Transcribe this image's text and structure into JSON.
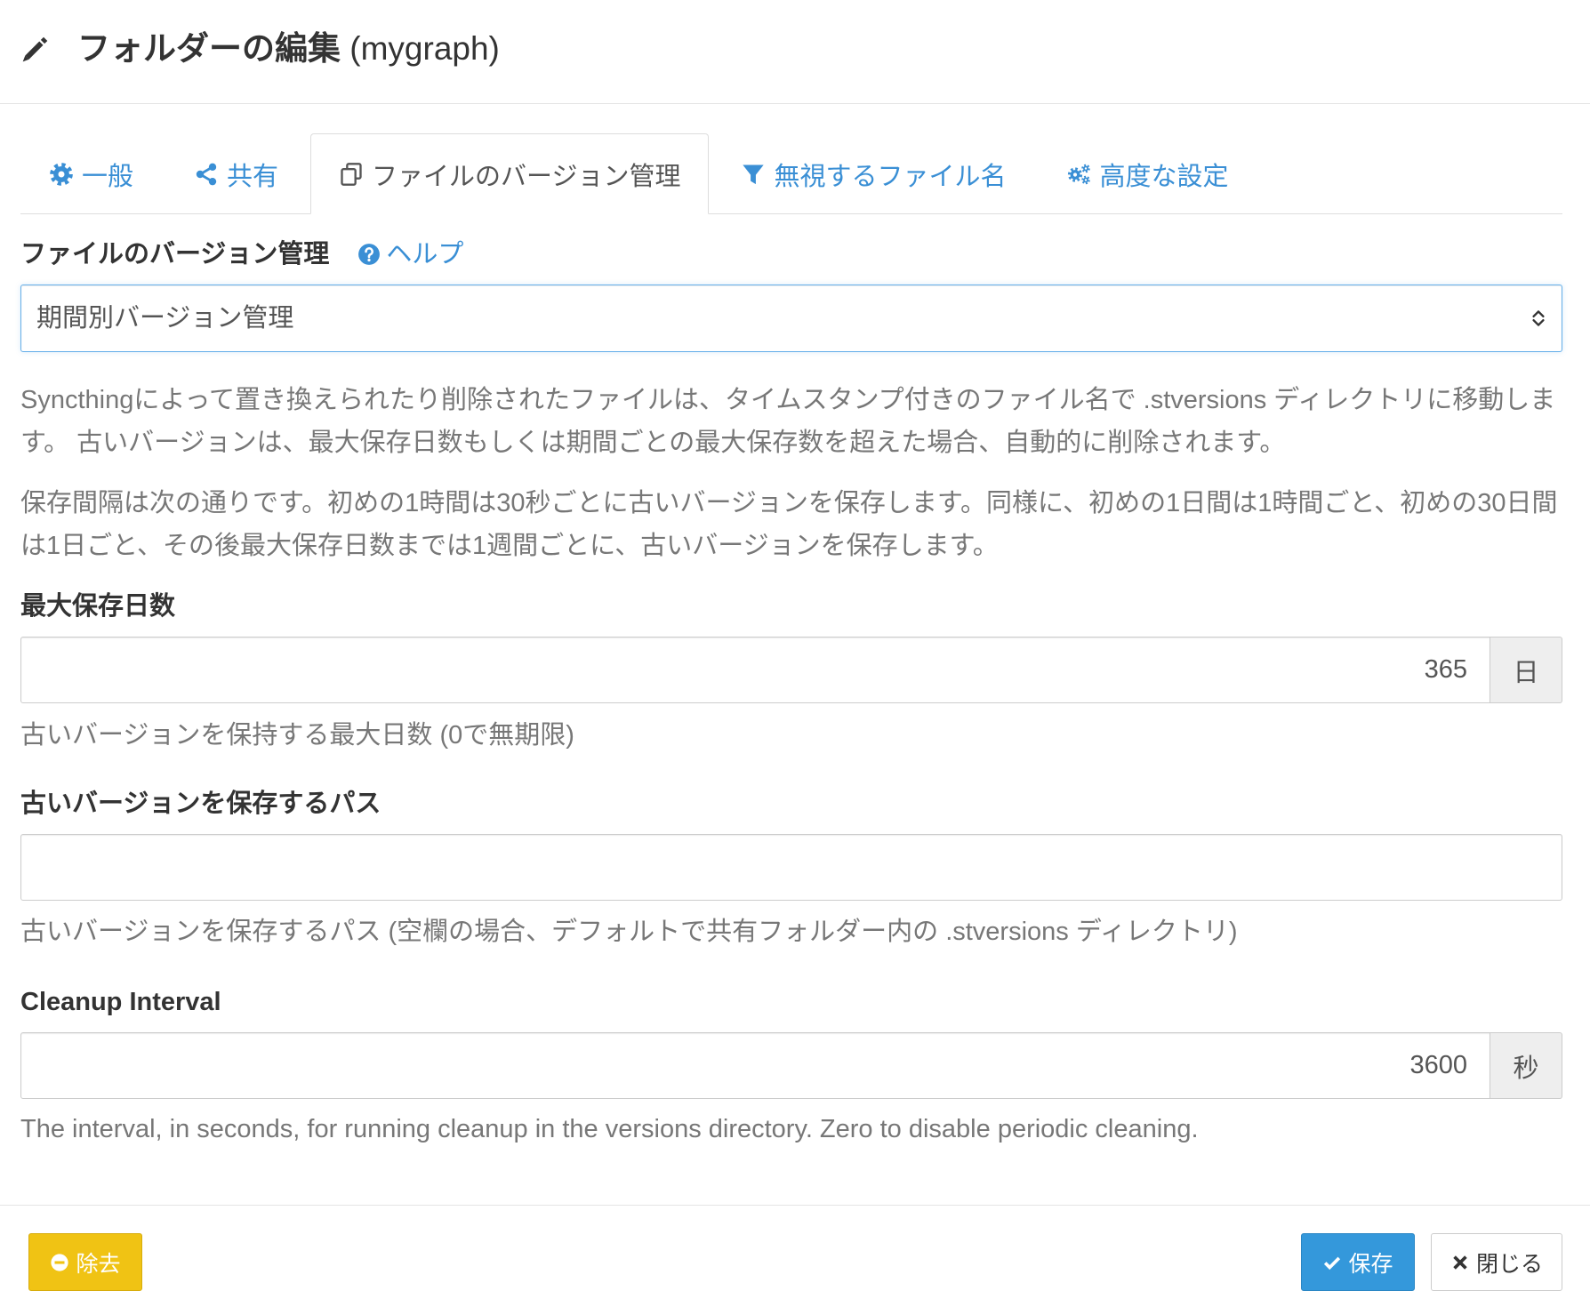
{
  "header": {
    "title": "フォルダーの編集",
    "folder": "(mygraph)"
  },
  "tabs": [
    {
      "label": "一般",
      "icon": "gear-icon"
    },
    {
      "label": "共有",
      "icon": "share-icon"
    },
    {
      "label": "ファイルのバージョン管理",
      "icon": "copy-icon",
      "active": true
    },
    {
      "label": "無視するファイル名",
      "icon": "filter-icon"
    },
    {
      "label": "高度な設定",
      "icon": "cogs-icon"
    }
  ],
  "versioning": {
    "label": "ファイルのバージョン管理",
    "help_icon": "question-circle-icon",
    "help_link": "ヘルプ",
    "selected": "期間別バージョン管理",
    "description": [
      "Syncthingによって置き換えられたり削除されたファイルは、タイムスタンプ付きのファイル名で .stversions ディレクトリに移動します。 古いバージョンは、最大保存日数もしくは期間ごとの最大保存数を超えた場合、自動的に削除されます。",
      "保存間隔は次の通りです。初めの1時間は30秒ごとに古いバージョンを保存します。同様に、初めの1日間は1時間ごと、初めの30日間は1日ごと、その後最大保存日数までは1週間ごとに、古いバージョンを保存します。"
    ]
  },
  "fields": {
    "max_age": {
      "label": "最大保存日数",
      "value": "365",
      "unit": "日",
      "help": "古いバージョンを保持する最大日数 (0で無期限)"
    },
    "versions_path": {
      "label": "古いバージョンを保存するパス",
      "value": "",
      "help": "古いバージョンを保存するパス (空欄の場合、デフォルトで共有フォルダー内の .stversions ディレクトリ)"
    },
    "cleanup_interval": {
      "label": "Cleanup Interval",
      "value": "3600",
      "unit": "秒",
      "help": "The interval, in seconds, for running cleanup in the versions directory. Zero to disable periodic cleaning."
    }
  },
  "footer": {
    "remove": {
      "label": "除去",
      "icon": "minus-circle-icon"
    },
    "save": {
      "label": "保存",
      "icon": "check-icon"
    },
    "close": {
      "label": "閉じる",
      "icon": "times-icon"
    }
  },
  "colors": {
    "link": "#3a8fd5",
    "text": "#333333",
    "muted": "#777777",
    "focus_border": "#66afe9",
    "warning": "#f0c314",
    "primary": "#3498db"
  }
}
